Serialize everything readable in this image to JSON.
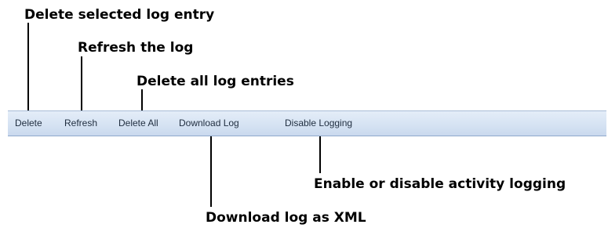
{
  "toolbar": {
    "buttons": [
      {
        "label": "Delete"
      },
      {
        "label": "Refresh"
      },
      {
        "label": "Delete All"
      },
      {
        "label": "Download Log"
      },
      {
        "label": "Disable Logging"
      }
    ]
  },
  "callouts": {
    "delete": "Delete selected log entry",
    "refresh": "Refresh the log",
    "delete_all": "Delete all log entries",
    "download": "Download log as XML",
    "disable": "Enable or disable activity logging"
  }
}
